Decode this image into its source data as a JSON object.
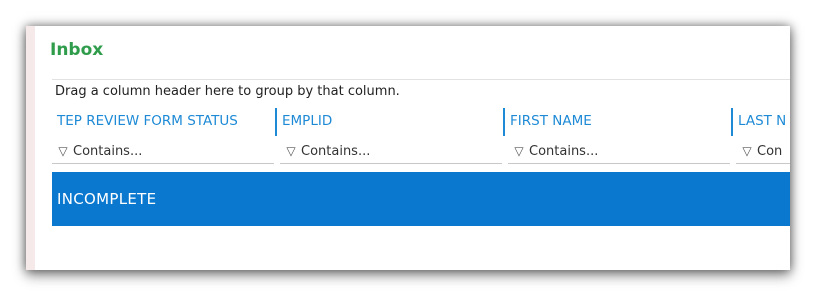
{
  "inbox": {
    "title": "Inbox"
  },
  "grid": {
    "group_panel_text": "Drag a column header here to group by that column.",
    "columns": [
      {
        "label": "TEP REVIEW FORM STATUS"
      },
      {
        "label": "EMPLID"
      },
      {
        "label": "FIRST NAME"
      },
      {
        "label": "LAST N"
      }
    ],
    "filter_placeholder": "Contains...",
    "filter_placeholder_clipped": "Con",
    "rows": [
      {
        "status": "INCOMPLETE"
      }
    ]
  },
  "icons": {
    "filter": "filter-icon"
  },
  "colors": {
    "title": "#2e9c4a",
    "header": "#1e8ad6",
    "selected_row": "#0b78d0"
  }
}
